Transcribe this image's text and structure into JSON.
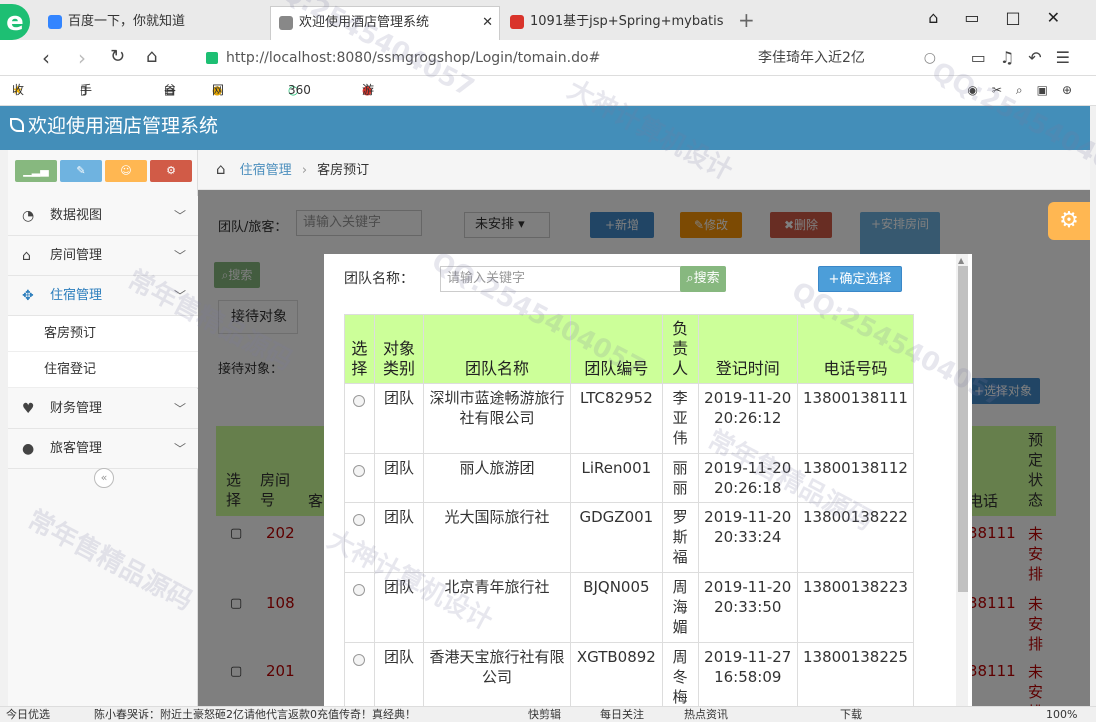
{
  "browser": {
    "tabs": [
      {
        "title": "百度一下，你就知道",
        "icon_color": "#3385ff"
      },
      {
        "title": "欢迎使用酒店管理系统",
        "icon_color": "#888888"
      },
      {
        "title": "1091基于jsp+Spring+mybatis",
        "icon_color": "#d9342b"
      }
    ],
    "url": "http://localhost:8080/ssmgrogshop/Login/tomain.do#",
    "search_text": "李佳琦年入近2亿",
    "bookmarks": [
      "收藏",
      "手机收藏夹",
      "谷歌",
      "网址大全",
      "360搜索",
      "游戏中心"
    ]
  },
  "app": {
    "title": "欢迎使用酒店管理系统",
    "accent": "#438eb9",
    "sidebar": {
      "menu": [
        {
          "label": "数据视图",
          "icon": "dashboard-icon"
        },
        {
          "label": "房间管理",
          "icon": "home-icon"
        },
        {
          "label": "住宿管理",
          "icon": "move-icon"
        },
        {
          "label": "财务管理",
          "icon": "heart-icon"
        },
        {
          "label": "旅客管理",
          "icon": "user-icon"
        }
      ],
      "submenu": [
        "客房预订",
        "住宿登记"
      ]
    },
    "breadcrumb": {
      "items": [
        "住宿管理",
        "客房预订"
      ]
    }
  },
  "background": {
    "filter_label": "团队/旅客：",
    "filter_placeholder": "请输入关键字",
    "select_value": "未安排",
    "buttons": [
      "新增",
      "修改",
      "删除",
      "安排房间"
    ],
    "search_button": "搜索",
    "tab_label": "接待对象",
    "reception_label": "接待对象：",
    "select_object_button": "选择对象",
    "table_headers": [
      "选择",
      "房间号",
      "客",
      "电话",
      "预定状态"
    ],
    "rows": [
      {
        "room": "202",
        "phone": "38111",
        "status": "未安排"
      },
      {
        "room": "108",
        "phone": "38111",
        "status": "未安排"
      },
      {
        "room": "201",
        "phone": "38111",
        "status": "未安排"
      }
    ]
  },
  "modal": {
    "label": "团队名称：",
    "placeholder": "请输入关键字",
    "search_button": "搜索",
    "confirm_button": "确定选择",
    "headers": [
      "选择",
      "对象类别",
      "团队名称",
      "团队编号",
      "负责人",
      "登记时间",
      "电话号码"
    ],
    "rows": [
      {
        "type": "团队",
        "name": "深圳市蓝途畅游旅行社有限公司",
        "code": "LTC82952",
        "person": "李亚伟",
        "time": "2019-11-20 20:26:12",
        "phone": "13800138111"
      },
      {
        "type": "团队",
        "name": "丽人旅游团",
        "code": "LiRen001",
        "person": "丽丽",
        "time": "2019-11-20 20:26:18",
        "phone": "13800138112"
      },
      {
        "type": "团队",
        "name": "光大国际旅行社",
        "code": "GDGZ001",
        "person": "罗斯福",
        "time": "2019-11-20 20:33:24",
        "phone": "13800138222"
      },
      {
        "type": "团队",
        "name": "北京青年旅行社",
        "code": "BJQN005",
        "person": "周海媚",
        "time": "2019-11-20 20:33:50",
        "phone": "13800138223"
      },
      {
        "type": "团队",
        "name": "香港天宝旅行社有限公司",
        "code": "XGTB0892",
        "person": "周冬梅",
        "time": "2019-11-27 16:58:09",
        "phone": "13800138225"
      }
    ]
  },
  "statusbar": {
    "items": [
      "今日优选",
      "陈小春哭诉：附近土豪怒砸2亿请他代言返款0充值传奇！真经典！",
      "快剪辑",
      "每日关注",
      "热点资讯",
      "下载",
      "100%"
    ]
  },
  "watermarks": [
    "QQ:2545404057",
    "常年售精品源码",
    "大神计算机设计"
  ]
}
